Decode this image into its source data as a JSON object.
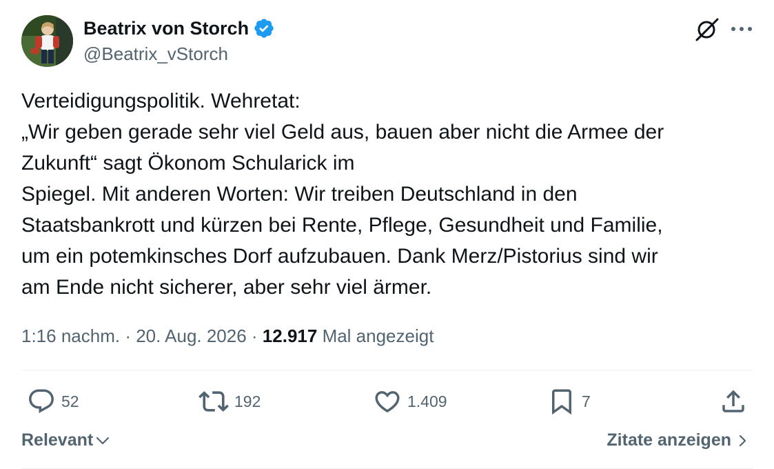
{
  "author": {
    "display_name": "Beatrix von Storch",
    "handle": "@Beatrix_vStorch",
    "verified": true
  },
  "tweet": {
    "lines": [
      "Verteidigungspolitik. Wehretat:",
      "„Wir geben gerade sehr viel Geld aus, bauen aber nicht die Armee der",
      "Zukunft“ sagt Ökonom Schularick im",
      "Spiegel. Mit anderen Worten: Wir treiben Deutschland in den",
      "Staatsbankrott und kürzen bei Rente, Pflege, Gesundheit und Familie,",
      "um ein potemkinsches Dorf aufzubauen. Dank Merz/Pistorius sind wir",
      "am Ende nicht sicherer, aber sehr viel ärmer."
    ]
  },
  "meta": {
    "time": "1:16 nachm.",
    "separator": " · ",
    "date": "20. Aug. 2026",
    "views_count": "12.917",
    "views_label": "Mal angezeigt"
  },
  "actions": {
    "replies": "52",
    "reposts": "192",
    "likes": "1.409",
    "bookmarks": "7"
  },
  "footer": {
    "sort_label": "Relevant",
    "quotes_label": "Zitate anzeigen"
  },
  "icons": {
    "verified_badge": "verified-badge-icon",
    "grok": "grok-icon",
    "more": "more-icon",
    "reply": "reply-icon",
    "repost": "repost-icon",
    "like": "heart-icon",
    "bookmark": "bookmark-icon",
    "share": "share-icon"
  },
  "colors": {
    "text_primary": "#0f1419",
    "text_secondary": "#536471",
    "verified_blue": "#1d9bf0",
    "divider": "#eff3f4"
  }
}
